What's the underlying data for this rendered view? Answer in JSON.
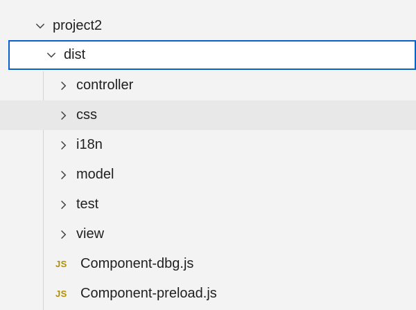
{
  "explorer": {
    "icons": {
      "expanded": "chevron-down-icon",
      "collapsed": "chevron-right-icon",
      "js_file": "js-file-icon"
    },
    "colors": {
      "selection_border": "#0a60c9",
      "hover_background": "#e8e8e8",
      "js_badge": "#b28f00"
    },
    "project_label": "project2",
    "dist_label": "dist",
    "folders": [
      {
        "label": "controller"
      },
      {
        "label": "css"
      },
      {
        "label": "i18n"
      },
      {
        "label": "model"
      },
      {
        "label": "test"
      },
      {
        "label": "view"
      }
    ],
    "files": [
      {
        "badge": "JS",
        "label": "Component-dbg.js"
      },
      {
        "badge": "JS",
        "label": "Component-preload.js"
      }
    ]
  }
}
